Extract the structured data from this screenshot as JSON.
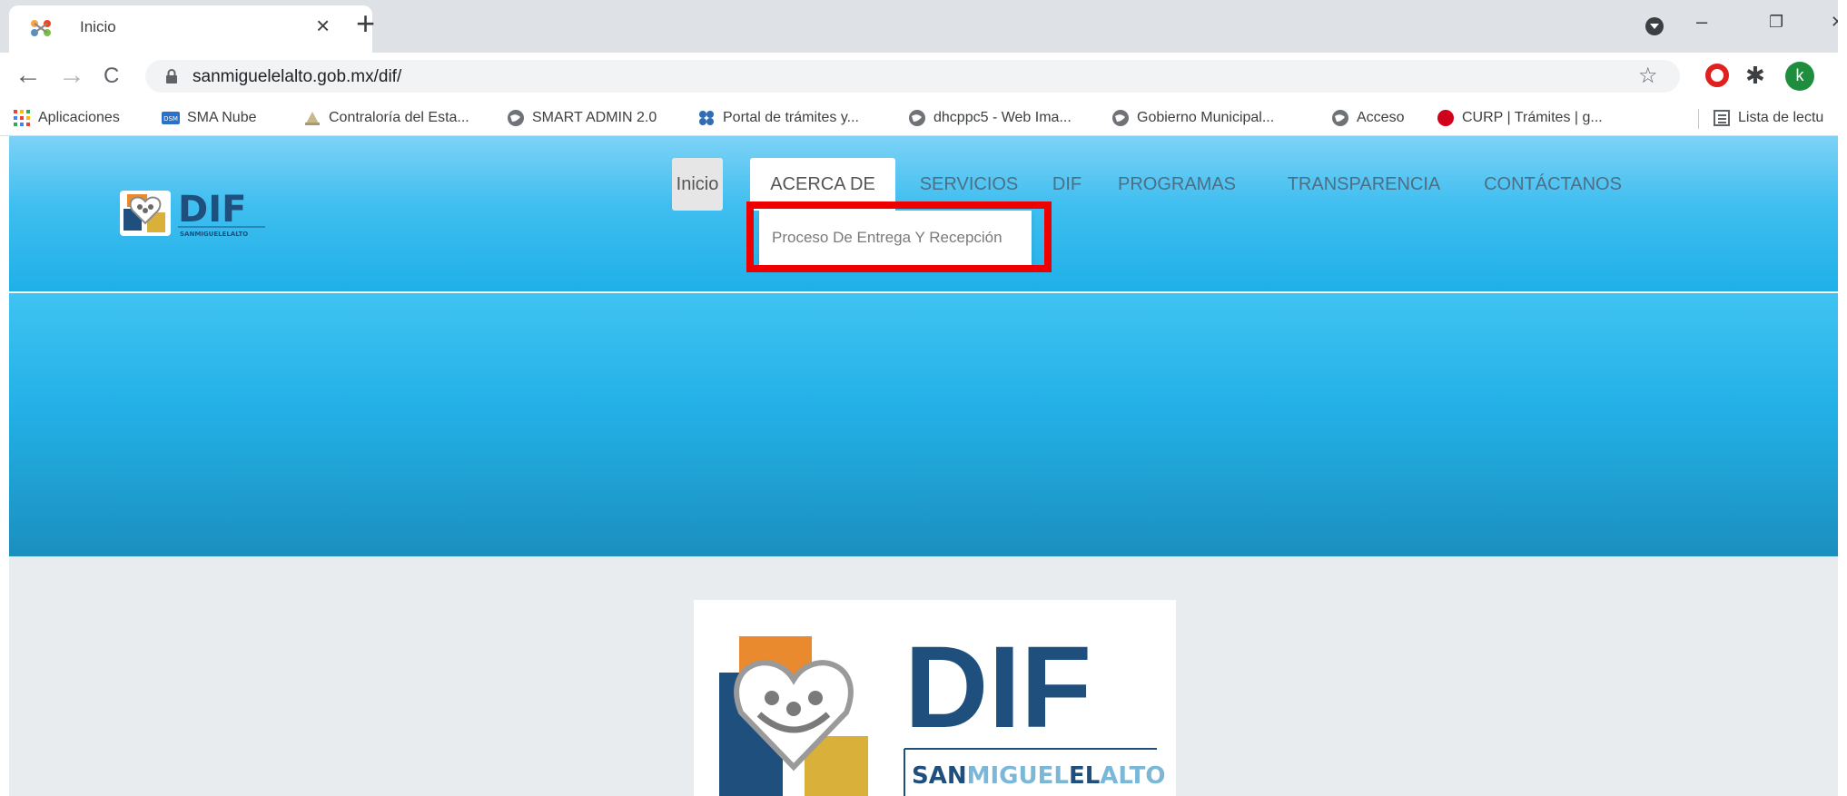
{
  "browser": {
    "tab": {
      "title": "Inicio",
      "close_glyph": "×"
    },
    "new_tab_glyph": "+",
    "window_controls": {
      "minimize": "–",
      "maximize": "❐",
      "close": "✕"
    },
    "toolbar": {
      "back_glyph": "←",
      "forward_glyph": "→",
      "reload_glyph": "C",
      "url": "sanmiguelelalto.gob.mx/dif/",
      "star_glyph": "☆",
      "avatar_letter": "k",
      "puzzle_glyph": "✱"
    },
    "bookmarks": [
      {
        "label": "Aplicaciones",
        "icon": "apps-grid-icon"
      },
      {
        "label": "SMA Nube",
        "icon": "dsm-icon"
      },
      {
        "label": "Contraloría del Esta...",
        "icon": "contraloria-icon"
      },
      {
        "label": "SMART ADMIN 2.0",
        "icon": "globe-icon"
      },
      {
        "label": "Portal de trámites y...",
        "icon": "portal-icon"
      },
      {
        "label": "dhcppc5 - Web Ima...",
        "icon": "globe-icon"
      },
      {
        "label": "Gobierno Municipal...",
        "icon": "globe-icon"
      },
      {
        "label": "Acceso",
        "icon": "globe-icon"
      },
      {
        "label": "CURP | Trámites | g...",
        "icon": "red-dot-icon"
      }
    ],
    "reading_list": {
      "label": "Lista de lectu",
      "icon": "reading-list-icon"
    }
  },
  "site": {
    "logo_text": "DIF",
    "logo_sub": "SANMIGUELELALTO",
    "nav": [
      {
        "label": "Inicio",
        "state": "active"
      },
      {
        "label": "ACERCA DE",
        "state": "open"
      },
      {
        "label": "SERVICIOS",
        "state": "normal"
      },
      {
        "label": "DIF",
        "state": "normal"
      },
      {
        "label": "PROGRAMAS",
        "state": "normal"
      },
      {
        "label": "TRANSPARENCIA",
        "state": "normal"
      },
      {
        "label": "CONTÁCTANOS",
        "state": "normal"
      }
    ],
    "dropdown": {
      "item": "Proceso De Entrega Y Recepción"
    },
    "content_logo": {
      "title": "DIF",
      "subtitle_san": "SAN",
      "subtitle_miguel": "MIGUEL",
      "subtitle_el": "EL",
      "subtitle_alto": "ALTO"
    }
  },
  "colors": {
    "header_top": "#7dd2f6",
    "header_bottom": "#1fb0e8",
    "hero_bottom": "#1b8fbe",
    "annotation": "#ee0000",
    "logo_navy": "#1f4f7d",
    "logo_orange": "#e88a2d",
    "logo_gold": "#d9b03a"
  }
}
